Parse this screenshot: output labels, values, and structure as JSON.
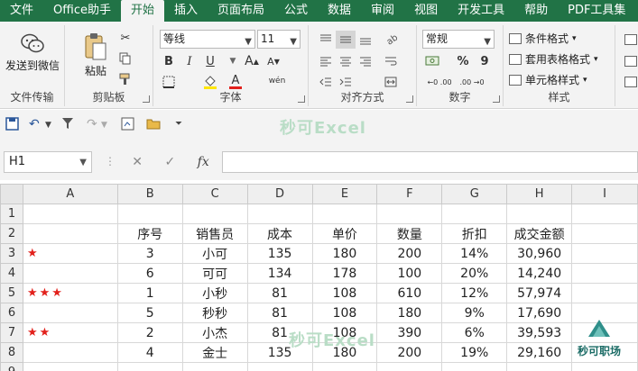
{
  "tabs": [
    "文件",
    "Office助手",
    "开始",
    "插入",
    "页面布局",
    "公式",
    "数据",
    "审阅",
    "视图",
    "开发工具",
    "帮助",
    "PDF工具集"
  ],
  "active_tab": "开始",
  "ribbon": {
    "file_transfer": {
      "button": "发送到微信",
      "label": "文件传输"
    },
    "clipboard": {
      "paste": "粘贴",
      "label": "剪贴板"
    },
    "font": {
      "name": "等线",
      "size": "11",
      "label": "字体",
      "bold": "B",
      "italic": "I",
      "underline": "U",
      "pinyin": "wén",
      "font_color_glyph": "A",
      "grow_glyph": "A",
      "shrink_glyph": "A"
    },
    "alignment": {
      "label": "对齐方式"
    },
    "number": {
      "format": "常规",
      "label": "数字",
      "percent": "%",
      "comma": "9",
      "dec_inc": "←0 .00",
      "dec_dec": ".00 →0"
    },
    "styles": {
      "conditional": "条件格式",
      "table": "套用表格格式",
      "cell": "单元格样式",
      "label": "样式"
    }
  },
  "watermark": "秒可Excel",
  "formula_bar": {
    "name_box": "H1",
    "fx": "fx",
    "value": ""
  },
  "sheet": {
    "columns": [
      "A",
      "B",
      "C",
      "D",
      "E",
      "F",
      "G",
      "H",
      "I"
    ],
    "row_numbers": [
      "1",
      "2",
      "3",
      "4",
      "5",
      "6",
      "7",
      "8",
      "9"
    ],
    "headers": [
      "序号",
      "销售员",
      "成本",
      "单价",
      "数量",
      "折扣",
      "成交金额"
    ],
    "rows": [
      {
        "stars": "★",
        "cells": [
          "3",
          "小可",
          "135",
          "180",
          "200",
          "14%",
          "30,960"
        ]
      },
      {
        "stars": "",
        "cells": [
          "6",
          "可可",
          "134",
          "178",
          "100",
          "20%",
          "14,240"
        ]
      },
      {
        "stars": "★★★",
        "cells": [
          "1",
          "小秒",
          "81",
          "108",
          "610",
          "12%",
          "57,974"
        ]
      },
      {
        "stars": "",
        "cells": [
          "5",
          "秒秒",
          "81",
          "108",
          "180",
          "9%",
          "17,690"
        ]
      },
      {
        "stars": "★★",
        "cells": [
          "2",
          "小杰",
          "81",
          "108",
          "390",
          "6%",
          "39,593"
        ]
      },
      {
        "stars": "",
        "cells": [
          "4",
          "金士",
          "135",
          "180",
          "200",
          "19%",
          "29,160"
        ]
      }
    ]
  },
  "logo": "秒可职场",
  "colors": {
    "brand": "#217346",
    "star": "#e2211c",
    "watermark": "#b9ddc6"
  }
}
